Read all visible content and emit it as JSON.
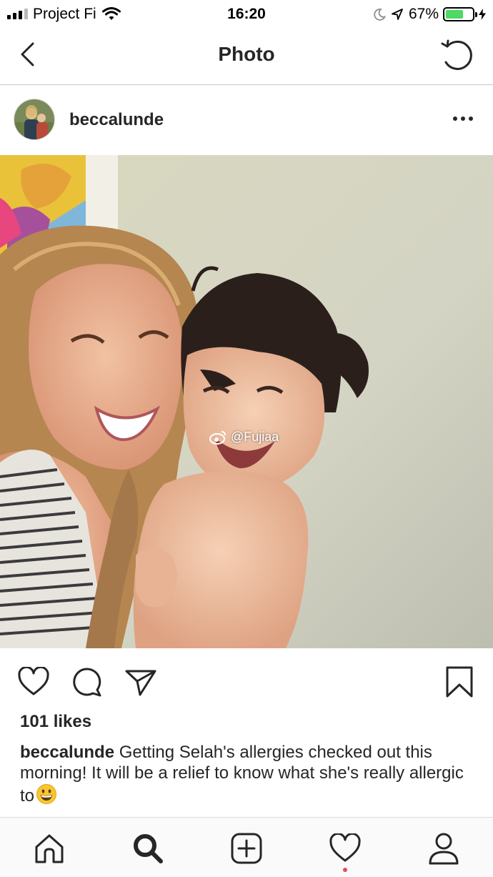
{
  "status_bar": {
    "carrier": "Project Fi",
    "time": "16:20",
    "battery_percent": "67%",
    "battery_level": 0.67,
    "signal_bars": 4,
    "signal_bars_filled": 3
  },
  "header": {
    "title": "Photo"
  },
  "post": {
    "username": "beccalunde",
    "watermark": "@Fujiaa",
    "likes": "101 likes",
    "caption_user": "beccalunde",
    "caption_text": "Getting Selah's allergies checked out this morning! It will be a relief to know what she's really allergic to"
  },
  "icons": {
    "back": "chevron-left-icon",
    "refresh": "refresh-icon",
    "more": "more-options-icon",
    "like": "heart-icon",
    "comment": "comment-icon",
    "share": "paper-plane-icon",
    "save": "bookmark-icon",
    "home": "home-icon",
    "search": "search-icon",
    "new_post": "plus-square-icon",
    "activity": "heart-icon",
    "profile": "profile-icon"
  },
  "colors": {
    "text": "#262626",
    "battery": "#4cd964",
    "notification": "#ed4956",
    "divider": "#dbdbdb"
  }
}
